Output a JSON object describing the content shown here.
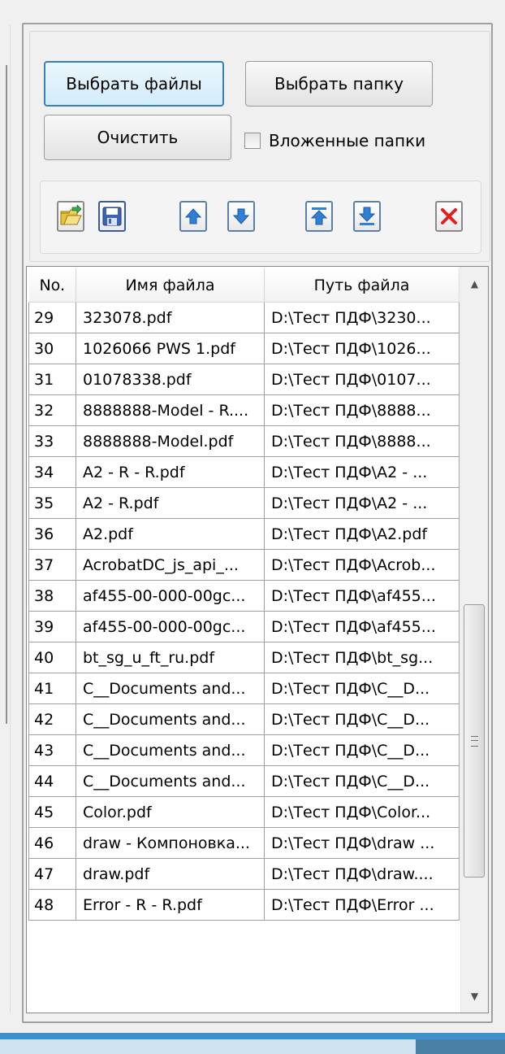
{
  "buttons": {
    "select_files": "Выбрать файлы",
    "select_folder": "Выбрать папку",
    "clear": "Очистить"
  },
  "checkbox": {
    "label": "Вложенные папки",
    "checked": false
  },
  "toolbar_icons": [
    "open-folder-icon",
    "save-icon",
    "move-up-icon",
    "move-down-icon",
    "move-to-top-icon",
    "move-to-bottom-icon",
    "delete-icon"
  ],
  "colors": {
    "accent": "#3c7fb1",
    "delete_red": "#e02020",
    "arrow_blue": "#2f7fd6"
  },
  "table": {
    "headers": [
      "No.",
      "Имя файла",
      "Путь файла"
    ],
    "rows": [
      [
        "29",
        "323078.pdf",
        "D:\\Тест ПДФ\\3230..."
      ],
      [
        "30",
        "1026066 PWS 1.pdf",
        "D:\\Тест ПДФ\\1026..."
      ],
      [
        "31",
        "01078338.pdf",
        "D:\\Тест ПДФ\\0107..."
      ],
      [
        "32",
        "8888888-Model - R....",
        "D:\\Тест ПДФ\\8888..."
      ],
      [
        "33",
        "8888888-Model.pdf",
        "D:\\Тест ПДФ\\8888..."
      ],
      [
        "34",
        "A2 - R - R.pdf",
        "D:\\Тест ПДФ\\A2 - ..."
      ],
      [
        "35",
        "A2 - R.pdf",
        "D:\\Тест ПДФ\\A2 - ..."
      ],
      [
        "36",
        "A2.pdf",
        "D:\\Тест ПДФ\\A2.pdf"
      ],
      [
        "37",
        "AcrobatDC_js_api_...",
        "D:\\Тест ПДФ\\Acrob..."
      ],
      [
        "38",
        "af455-00-000-00gc...",
        "D:\\Тест ПДФ\\af455..."
      ],
      [
        "39",
        "af455-00-000-00gc...",
        "D:\\Тест ПДФ\\af455..."
      ],
      [
        "40",
        "bt_sg_u_ft_ru.pdf",
        "D:\\Тест ПДФ\\bt_sg..."
      ],
      [
        "41",
        "C__Documents and...",
        "D:\\Тест ПДФ\\C__D..."
      ],
      [
        "42",
        "C__Documents and...",
        "D:\\Тест ПДФ\\C__D..."
      ],
      [
        "43",
        "C__Documents and...",
        "D:\\Тест ПДФ\\C__D..."
      ],
      [
        "44",
        "C__Documents and...",
        "D:\\Тест ПДФ\\C__D..."
      ],
      [
        "45",
        "Color.pdf",
        "D:\\Тест ПДФ\\Color..."
      ],
      [
        "46",
        "draw - Компоновка...",
        "D:\\Тест ПДФ\\draw ..."
      ],
      [
        "47",
        "draw.pdf",
        "D:\\Тест ПДФ\\draw...."
      ],
      [
        "48",
        "Error - R - R.pdf",
        "D:\\Тест ПДФ\\Error ..."
      ]
    ]
  }
}
